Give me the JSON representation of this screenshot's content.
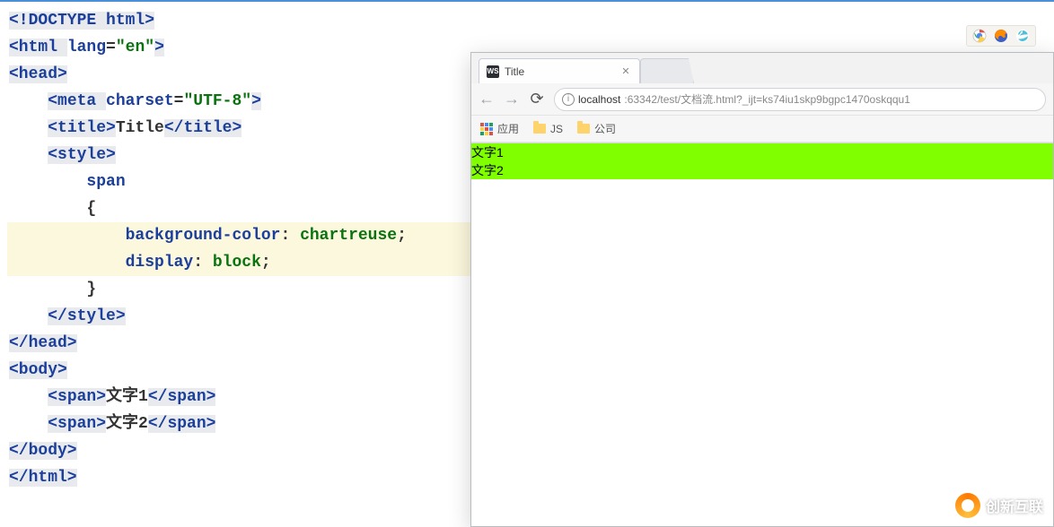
{
  "code": {
    "l1": "<!DOCTYPE html>",
    "l2_open": "<html ",
    "l2_attr": "lang",
    "l2_eq": "=",
    "l2_val": "\"en\"",
    "l2_close": ">",
    "l3": "<head>",
    "l4_open": "<meta ",
    "l4_attr": "charset",
    "l4_eq": "=",
    "l4_val": "\"UTF-8\"",
    "l4_close": ">",
    "l5_open": "<title>",
    "l5_text": "Title",
    "l5_close": "</title>",
    "l6": "<style>",
    "l7": "span",
    "l8": "{",
    "l9_prop": "background-color",
    "l9_colon": ": ",
    "l9_val": "chartreuse",
    "l9_semi": ";",
    "l10_prop": "display",
    "l10_colon": ": ",
    "l10_val": "block",
    "l10_semi": ";",
    "l11": "}",
    "l12": "</style>",
    "l13": "</head>",
    "l14": "<body>",
    "l15_open": "<span>",
    "l15_text": "文字1",
    "l15_close": "</span>",
    "l16_open": "<span>",
    "l16_text": "文字2",
    "l16_close": "</span>",
    "l17": "</body>",
    "l18": "</html>"
  },
  "browser": {
    "tab_favicon": "WS",
    "tab_title": "Title",
    "url_host": "localhost",
    "url_rest": ":63342/test/文档流.html?_ijt=ks74iu1skp9bgpc1470oskqqu1",
    "bookmarks": {
      "apps": "应用",
      "js": "JS",
      "company": "公司"
    },
    "page": {
      "line1": "文字1",
      "line2": "文字2"
    }
  },
  "watermark": "创新互联"
}
